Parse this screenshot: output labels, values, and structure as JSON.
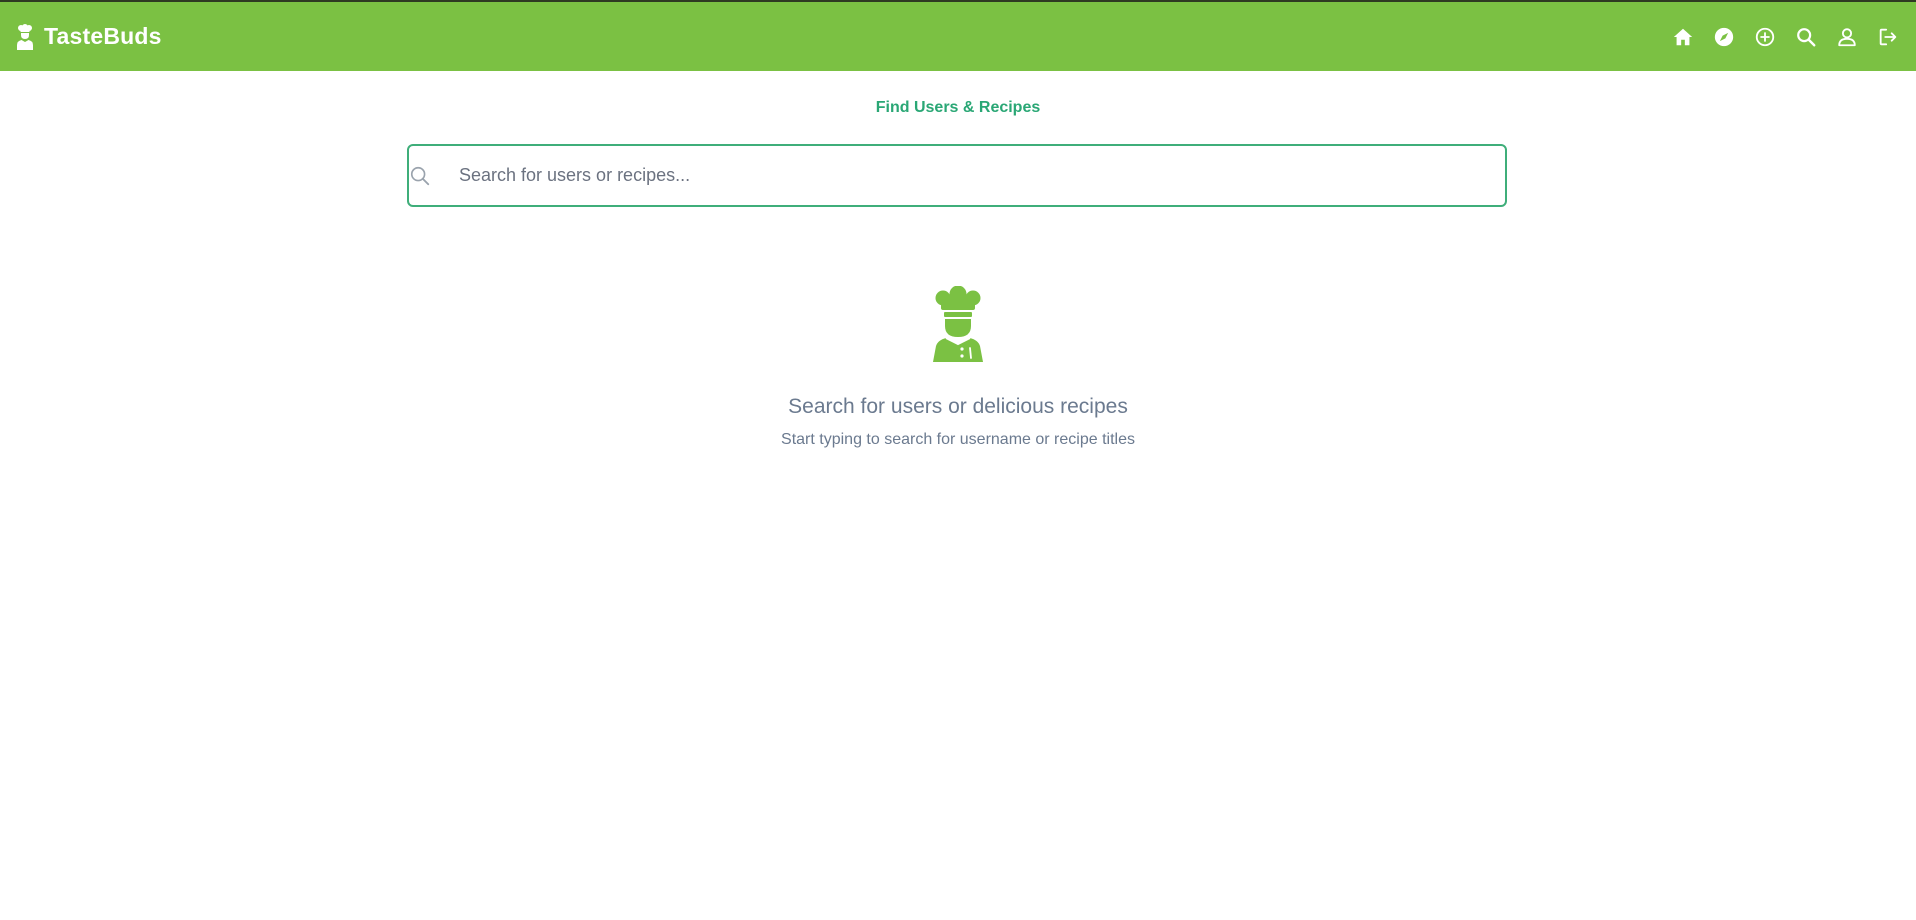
{
  "header": {
    "brand_name": "TasteBuds",
    "nav_icons": [
      "home-icon",
      "explore-icon",
      "add-icon",
      "search-icon",
      "profile-icon",
      "logout-icon"
    ]
  },
  "search_page": {
    "title": "Find Users & Recipes",
    "search_placeholder": "Search for users or recipes...",
    "search_value": ""
  },
  "empty_state": {
    "icon": "chef-icon",
    "title": "Search for users or delicious recipes",
    "subtitle": "Start typing to search for username or recipe titles"
  },
  "colors": {
    "navbar": "#7bc143",
    "accent": "#2aa775",
    "search_border": "#3fae7a",
    "muted_text": "#6b7a8f"
  }
}
